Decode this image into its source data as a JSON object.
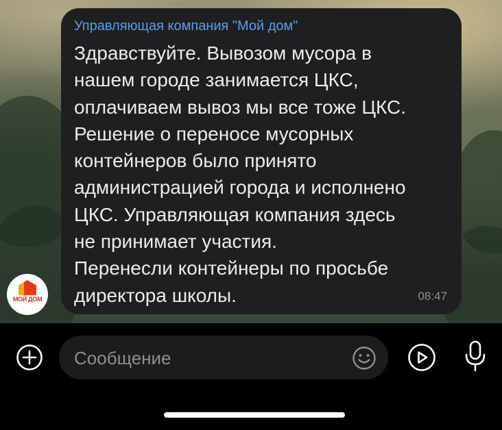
{
  "chat": {
    "message": {
      "sender": "Управляющая компания \"Мой дом\"",
      "lines": [
        "Здравствуйте. Вывозом мусора в",
        "нашем городе занимается ЦКС,",
        "оплачиваем вывоз мы все тоже ЦКС.",
        "Решение о переносе мусорных",
        "контейнеров было принято",
        "администрацией города и исполнено",
        "ЦКС. Управляющая компания здесь",
        "не принимает участия.",
        "Перенесли контейнеры по просьбе",
        "директора школы."
      ],
      "time": "08:47"
    },
    "avatar": {
      "logo_text": "МОЙ ДОМ"
    }
  },
  "composer": {
    "placeholder": "Сообщение",
    "icons": {
      "attach": "plus-circle-icon",
      "emoji": "smiley-icon",
      "video": "play-circle-icon",
      "voice": "microphone-icon"
    }
  },
  "colors": {
    "bubble_bg": "#1f1f21",
    "sender_name": "#5a9ce8",
    "message_text": "#ececec",
    "timestamp": "#8e8e93",
    "input_bg": "#1c1c1e"
  }
}
